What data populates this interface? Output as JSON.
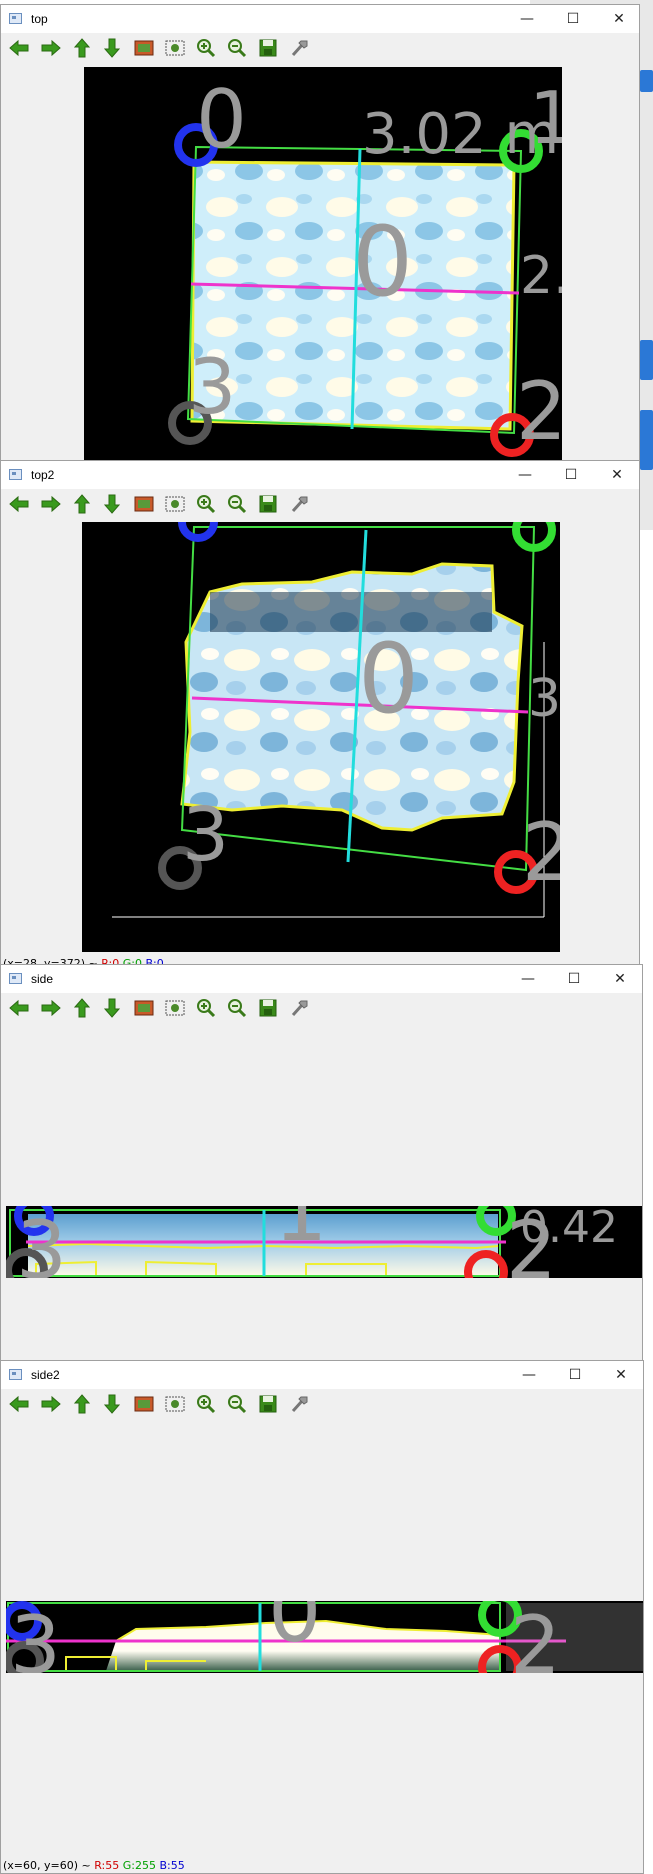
{
  "windows": [
    {
      "title": "top"
    },
    {
      "title": "top2"
    },
    {
      "title": "side"
    },
    {
      "title": "side2"
    }
  ],
  "window_buttons": {
    "minimize": "—",
    "maximize": "☐",
    "close": "✕"
  },
  "toolbar_icons": [
    "arrow-left-icon",
    "arrow-right-icon",
    "arrow-up-icon",
    "arrow-down-icon",
    "image-icon",
    "zoom-region-icon",
    "zoom-in-icon",
    "zoom-out-icon",
    "save-icon",
    "properties-icon"
  ],
  "overlays": {
    "top": {
      "corner0": "0",
      "corner1": "1",
      "corner2": "2",
      "corner3": "3",
      "center": "0",
      "width_label": "3.02 m",
      "side_label": "2."
    },
    "top2": {
      "corner2": "2",
      "corner3": "3",
      "center": "0",
      "side_label": "3"
    },
    "side": {
      "corner2": "2",
      "corner3": "3",
      "center": "1",
      "side_label": "0.42"
    },
    "side2": {
      "corner2": "2",
      "corner3": "3",
      "center": "0"
    }
  },
  "status_top2": {
    "coords": "(x=28, y=372) ~",
    "r": "R:0",
    "g": "G:0",
    "b": "B:0"
  },
  "status_side2": {
    "coords": "(x=60, y=60) ~",
    "r": "R:55",
    "g": "G:255",
    "b": "B:55"
  },
  "colors": {
    "corner0": "#2233ee",
    "corner1": "#33dd33",
    "corner2": "#ee2222",
    "corner3": "#555555",
    "label": "#9a9a9a",
    "axis_h": "#ee33cc",
    "axis_v": "#22dddd",
    "outline": "#eeee33",
    "frame": "#44dd44"
  }
}
